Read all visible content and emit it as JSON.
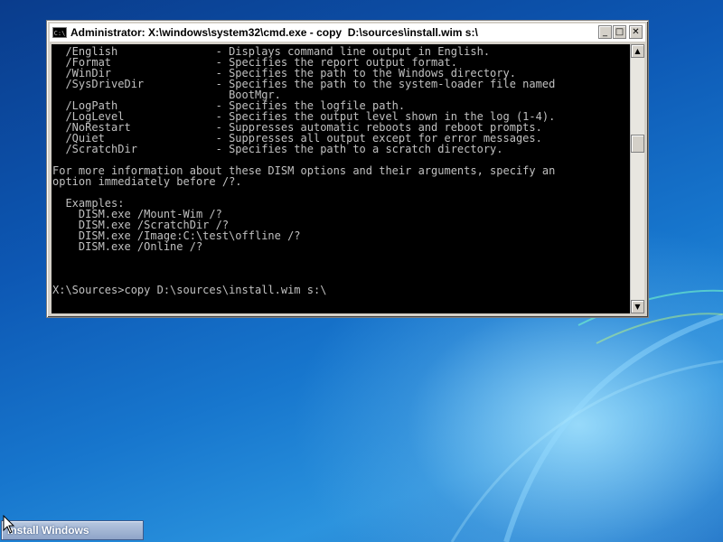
{
  "window": {
    "title": "Administrator: X:\\windows\\system32\\cmd.exe - copy  D:\\sources\\install.wim s:\\",
    "icon_text": "C:\\",
    "minimize_glyph": "_",
    "maximize_glyph": "□",
    "close_glyph": "✕"
  },
  "console": {
    "lines": [
      "  /English               - Displays command line output in English.",
      "  /Format                - Specifies the report output format.",
      "  /WinDir                - Specifies the path to the Windows directory.",
      "  /SysDriveDir           - Specifies the path to the system-loader file named",
      "                           BootMgr.",
      "  /LogPath               - Specifies the logfile path.",
      "  /LogLevel              - Specifies the output level shown in the log (1-4).",
      "  /NoRestart             - Suppresses automatic reboots and reboot prompts.",
      "  /Quiet                 - Suppresses all output except for error messages.",
      "  /ScratchDir            - Specifies the path to a scratch directory.",
      "",
      "For more information about these DISM options and their arguments, specify an",
      "option immediately before /?.",
      "",
      "  Examples:",
      "    DISM.exe /Mount-Wim /?",
      "    DISM.exe /ScratchDir /?",
      "    DISM.exe /Image:C:\\test\\offline /?",
      "    DISM.exe /Online /?",
      "",
      "",
      "",
      "X:\\Sources>copy D:\\sources\\install.wim s:\\"
    ]
  },
  "scrollbar": {
    "up_glyph": "▲",
    "down_glyph": "▼"
  },
  "taskbar": {
    "install_label": "Install Windows"
  },
  "colors": {
    "console_bg": "#000000",
    "console_fg": "#c0c0c0",
    "desktop": "#1776cd"
  },
  "icons": [
    "cmd-icon",
    "minimize-icon",
    "maximize-icon",
    "close-icon",
    "arrow-cursor-icon"
  ]
}
